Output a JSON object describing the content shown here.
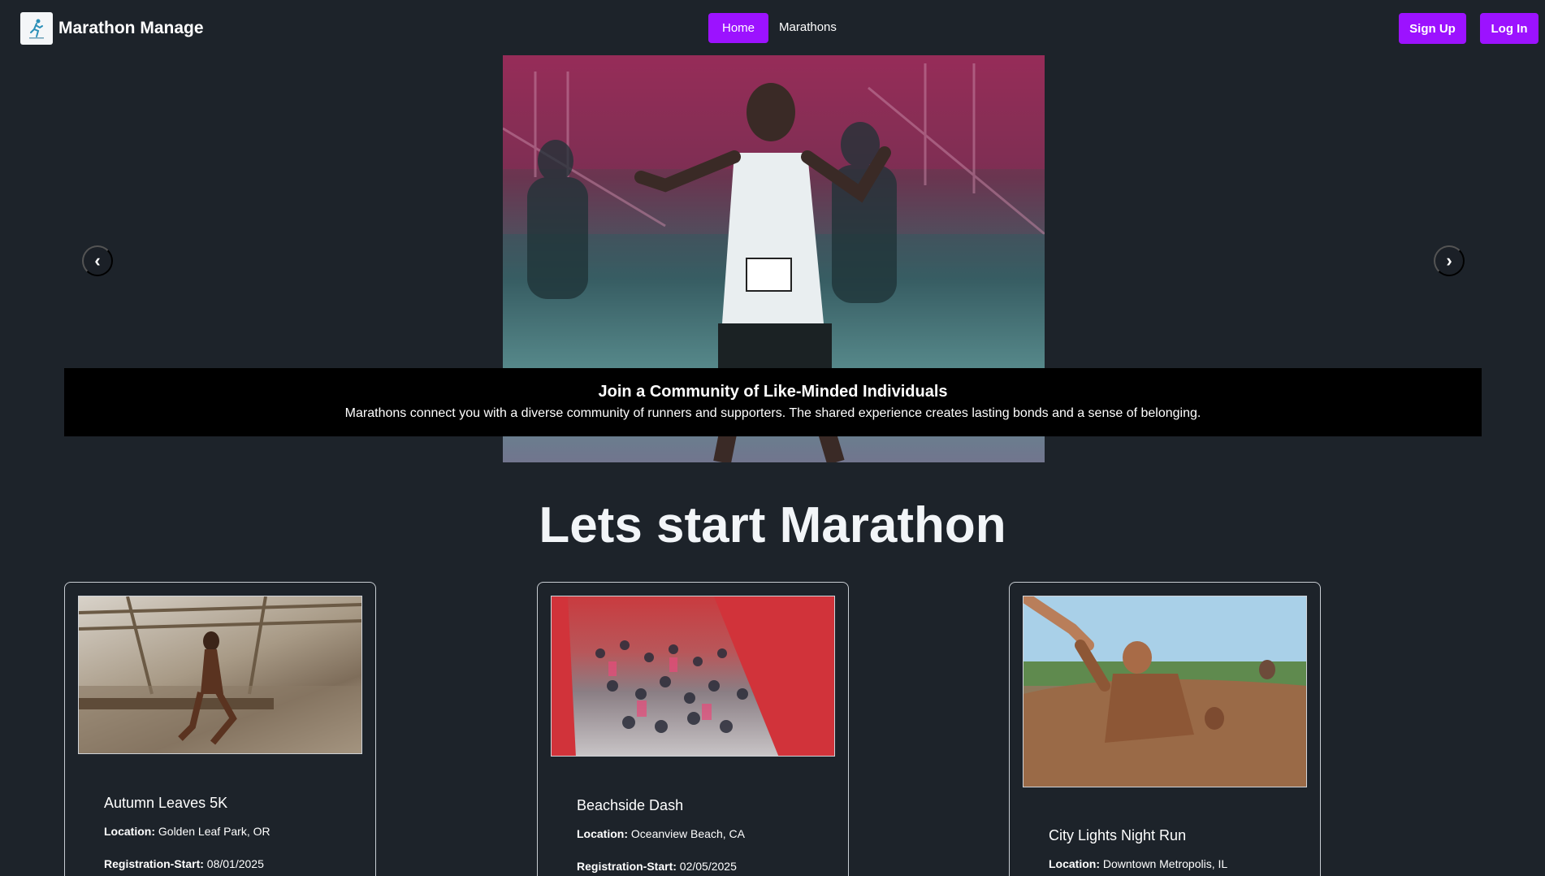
{
  "brand": {
    "name": "Marathon Manage",
    "logo_icon": "runner-logo-icon"
  },
  "nav": {
    "home": "Home",
    "marathons": "Marathons"
  },
  "auth": {
    "signup": "Sign Up",
    "login": "Log In"
  },
  "colors": {
    "accent": "#9c12ff",
    "background": "#1d232a",
    "caption_bg": "#000000"
  },
  "carousel": {
    "prev_icon": "chevron-left-icon",
    "next_icon": "chevron-right-icon",
    "slide_title": "Join a Community of Like-Minded Individuals",
    "slide_text": "Marathons connect you with a diverse community of runners and supporters. The shared experience creates lasting bonds and a sense of belonging."
  },
  "section_title": "Lets start Marathon",
  "cards": [
    {
      "title": "Autumn Leaves 5K",
      "location_label": "Location:",
      "location": "Golden Leaf Park, OR",
      "reg_label": "Registration-Start:",
      "reg_start": "08/01/2025"
    },
    {
      "title": "Beachside Dash",
      "location_label": "Location:",
      "location": "Oceanview Beach, CA",
      "reg_label": "Registration-Start:",
      "reg_start": "02/05/2025"
    },
    {
      "title": "City Lights Night Run",
      "location_label": "Location:",
      "location": "Downtown Metropolis, IL"
    }
  ]
}
